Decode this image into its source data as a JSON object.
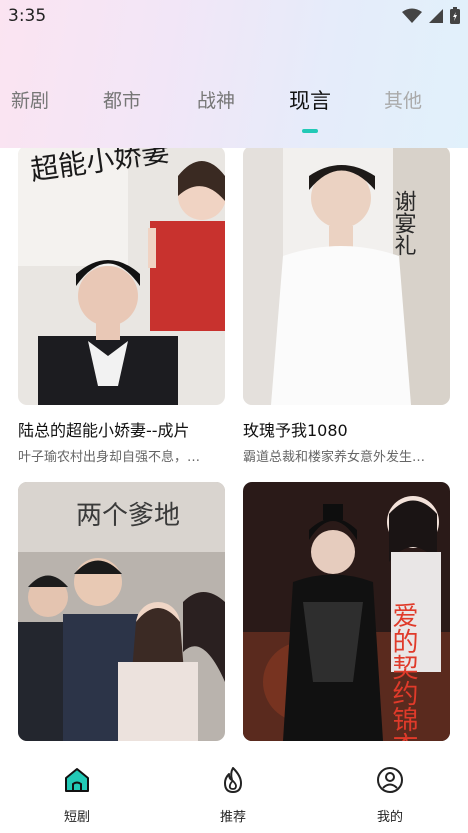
{
  "status": {
    "time": "3:35"
  },
  "tabs": [
    {
      "label": "新剧"
    },
    {
      "label": "都市"
    },
    {
      "label": "战神"
    },
    {
      "label": "现言"
    },
    {
      "label": "其他"
    }
  ],
  "cards": [
    {
      "title": "陆总的超能小娇妻--成片",
      "desc": "叶子瑜农村出身却自强不息，…",
      "poster_text": "超能小娇妻"
    },
    {
      "title": "玫瑰予我1080",
      "desc": "霸道总裁和楼家养女意外发生…",
      "poster_text": "谢宴礼"
    },
    {
      "title": "",
      "desc": "",
      "poster_text": "两个爹地"
    },
    {
      "title": "",
      "desc": "",
      "poster_text": "爱的契约锦衣"
    }
  ],
  "nav": [
    {
      "label": "短剧",
      "icon": "home-icon"
    },
    {
      "label": "推荐",
      "icon": "flame-icon"
    },
    {
      "label": "我的",
      "icon": "profile-icon"
    }
  ],
  "colors": {
    "accent": "#22c9b6"
  }
}
